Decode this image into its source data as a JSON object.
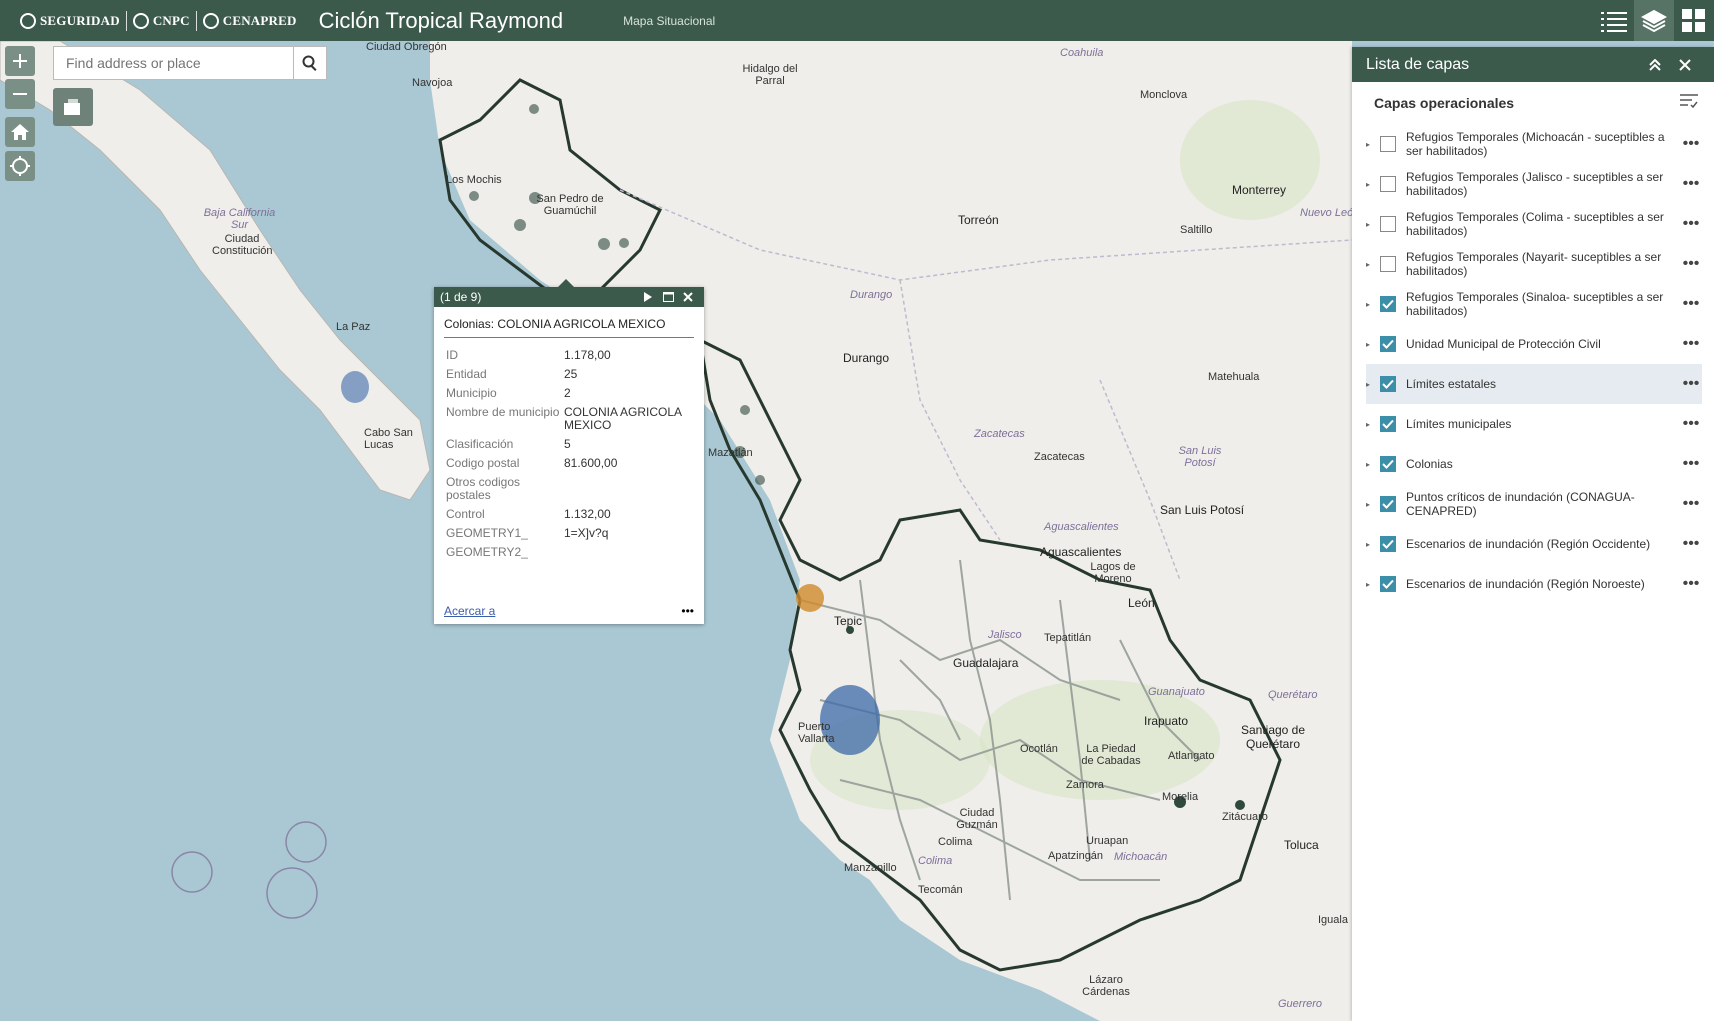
{
  "header": {
    "logos": [
      "SEGURIDAD",
      "CNPC",
      "CENAPRED"
    ],
    "title": "Ciclón Tropical Raymond",
    "subtitle": "Mapa Situacional",
    "icons": [
      "list-icon",
      "layers-icon",
      "grid-icon"
    ]
  },
  "search": {
    "placeholder": "Find address or place"
  },
  "map": {
    "labels": {
      "ciudad_obregon": "Ciudad Obregón",
      "navojoa": "Navojoa",
      "hidalgo": "Hidalgo del Parral",
      "coahuila": "Coahuila",
      "monclova": "Monclova",
      "monterrey": "Monterrey",
      "nuevo_leon": "Nuevo León",
      "torreon": "Torreón",
      "saltillo": "Saltillo",
      "baja_california_sur": "Baja California Sur",
      "ciudad_constitucion": "Ciudad Constitución",
      "la_paz": "La Paz",
      "cabo_san_lucas": "Cabo San Lucas",
      "los_mochis": "Los Mochis",
      "san_pedro": "San Pedro de Guamúchil",
      "durango_state": "Durango",
      "durango_city": "Durango",
      "matehuala": "Matehuala",
      "zacatecas_state": "Zacatecas",
      "zacatecas_city": "Zacatecas",
      "san_luis_potosi_state": "San Luis Potosí",
      "san_luis_potosi_city": "San Luis Potosí",
      "aguascalientes_state": "Aguascalientes",
      "aguascalientes_city": "Aguascalientes",
      "lagos": "Lagos de Moreno",
      "leon": "León",
      "tepic": "Tepic",
      "jalisco": "Jalisco",
      "guadalajara": "Guadalajara",
      "tepatitlan": "Tepatitlán",
      "guanajuato": "Guanajuato",
      "queretaro": "Querétaro",
      "irapuato": "Irapuato",
      "santiago": "Santiago de Querétaro",
      "la_piedad": "La Piedad de Cabadas",
      "zamora": "Zamora",
      "morelia": "Morelia",
      "zitacuaro": "Zitácuaro",
      "toluca": "Toluca",
      "uruapan": "Uruapan",
      "apatzingan": "Apatzingán",
      "michoacan": "Michoacán",
      "ciudad_guzman": "Ciudad Guzmán",
      "colima_city": "Colima",
      "colima_state": "Colima",
      "manzanillo": "Manzanillo",
      "tecoman": "Tecomán",
      "lazaro": "Lázaro Cárdenas",
      "iguala": "Iguala",
      "guerrero": "Guerrero",
      "vallarta": "Puerto Vallarta",
      "mazatlan": "Mazatlán",
      "ocotlan": "Ocotlán",
      "atlangato": "Atlangato"
    }
  },
  "popup": {
    "count": "(1 de 9)",
    "title": "Colonias: COLONIA AGRICOLA MEXICO",
    "fields": [
      {
        "key": "ID",
        "value": "1.178,00"
      },
      {
        "key": "Entidad",
        "value": "25"
      },
      {
        "key": "Municipio",
        "value": "2"
      },
      {
        "key": "Nombre de municipio",
        "value": "COLONIA AGRICOLA MEXICO"
      },
      {
        "key": "Clasificación",
        "value": "5"
      },
      {
        "key": "Codigo postal",
        "value": "81.600,00"
      },
      {
        "key": "Otros codigos postales",
        "value": ""
      },
      {
        "key": "Control",
        "value": "1.132,00"
      },
      {
        "key": "GEOMETRY1_",
        "value": "1=X]v?q"
      },
      {
        "key": "GEOMETRY2_",
        "value": ""
      }
    ],
    "zoom_link": "Acercar a",
    "more": "•••"
  },
  "layer_panel": {
    "title": "Lista de capas",
    "section": "Capas operacionales",
    "layers": [
      {
        "label": "Refugios Temporales (Michoacán - suceptibles a ser habilitados)",
        "checked": false
      },
      {
        "label": "Refugios Temporales (Jalisco - suceptibles a ser habilitados)",
        "checked": false
      },
      {
        "label": "Refugios Temporales (Colima - suceptibles a ser habilitados)",
        "checked": false
      },
      {
        "label": "Refugios Temporales (Nayarit- suceptibles a ser habilitados)",
        "checked": false
      },
      {
        "label": "Refugios Temporales (Sinaloa- suceptibles a ser habilitados)",
        "checked": true
      },
      {
        "label": "Unidad Municipal de Protección Civil",
        "checked": true
      },
      {
        "label": "Límites estatales",
        "checked": true
      },
      {
        "label": "Límites municipales",
        "checked": true
      },
      {
        "label": "Colonias",
        "checked": true
      },
      {
        "label": "Puntos críticos de inundación (CONAGUA-CENAPRED)",
        "checked": true
      },
      {
        "label": "Escenarios de inundación (Región Occidente)",
        "checked": true
      },
      {
        "label": "Escenarios de inundación (Región Noroeste)",
        "checked": true
      }
    ],
    "more": "•••"
  },
  "colors": {
    "header": "#3b5a4c",
    "land": "#efeeea",
    "water": "#aac8d3",
    "checkbox": "#3b8fa8",
    "boundary": "#27392f"
  }
}
